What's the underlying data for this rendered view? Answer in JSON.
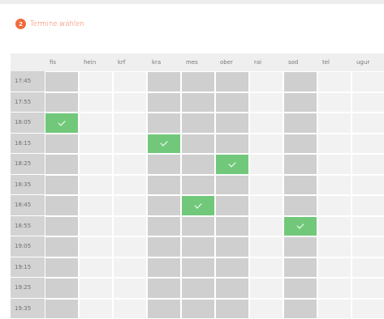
{
  "header": {
    "step_number": "2",
    "step_title": "Termine wählen"
  },
  "schedule": {
    "columns": [
      "fis",
      "hein",
      "krf",
      "kra",
      "mes",
      "ober",
      "rai",
      "sod",
      "tel",
      "ugur"
    ],
    "times": [
      "17:45",
      "17:55",
      "18:05",
      "18:15",
      "18:25",
      "18:35",
      "18:45",
      "18:55",
      "19:05",
      "19:15",
      "19:25",
      "19:35"
    ],
    "available_columns": [
      "fis",
      "kra",
      "mes",
      "ober",
      "sod"
    ],
    "selected": [
      {
        "column": "fis",
        "time": "18:05"
      },
      {
        "column": "kra",
        "time": "18:15"
      },
      {
        "column": "ober",
        "time": "18:25"
      },
      {
        "column": "mes",
        "time": "18:45"
      },
      {
        "column": "sod",
        "time": "18:55"
      }
    ],
    "colors": {
      "unavailable": "#cfcfcf",
      "available": "#f2f2f2",
      "selected": "#72c87a",
      "accent": "#f06a3a"
    }
  }
}
